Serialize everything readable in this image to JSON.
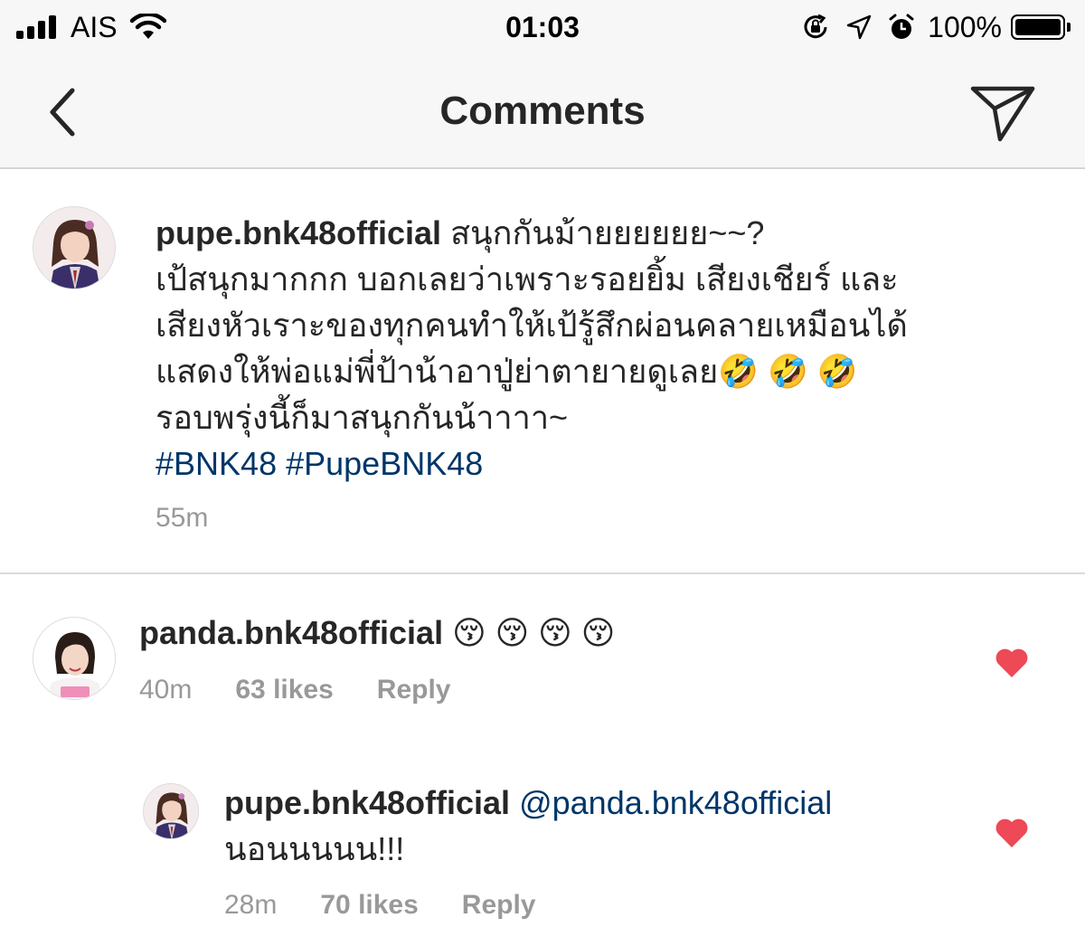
{
  "status_bar": {
    "carrier": "AIS",
    "time": "01:03",
    "battery_percent": "100%",
    "battery_level": 1.0,
    "icons": [
      "signal-icon",
      "wifi-icon",
      "rotation-lock-icon",
      "location-arrow-icon",
      "alarm-icon",
      "battery-icon"
    ]
  },
  "header": {
    "title": "Comments",
    "back_icon": "chevron-left-icon",
    "share_icon": "direct-send-icon"
  },
  "caption": {
    "username": "pupe.bnk48official",
    "line1": "สนุกกันม้ายยยยยย~~?",
    "line2": "เป้สนุกมากกก บอกเลยว่าเพราะรอยยิ้ม เสียงเชียร์ และ",
    "line3": "เสียงหัวเราะของทุกคนทำให้เป้รู้สึกผ่อนคลายเหมือนได้",
    "line4": "แสดงให้พ่อแม่พี่ป้าน้าอาปู่ย่าตายายดูเลย🤣 🤣 🤣",
    "line5": "รอบพรุ่งนี้ก็มาสนุกกันน้าาาา~",
    "hashtag1": "#BNK48",
    "hashtag2": "#PupeBNK48",
    "time": "55m"
  },
  "comments": [
    {
      "username": "panda.bnk48official",
      "text": "😚 😚 😚 😚",
      "time": "40m",
      "likes": "63 likes",
      "reply": "Reply",
      "liked": true,
      "heart_color": "#ed4956"
    },
    {
      "username": "pupe.bnk48official",
      "mention": "@panda.bnk48official",
      "text": "นอนนนนน!!!",
      "time": "28m",
      "likes": "70 likes",
      "reply": "Reply",
      "liked": true,
      "heart_color": "#ed4956"
    }
  ],
  "colors": {
    "link": "#003569",
    "meta": "#999999",
    "header_bg": "#f7f7f7",
    "heart": "#ed4956"
  }
}
